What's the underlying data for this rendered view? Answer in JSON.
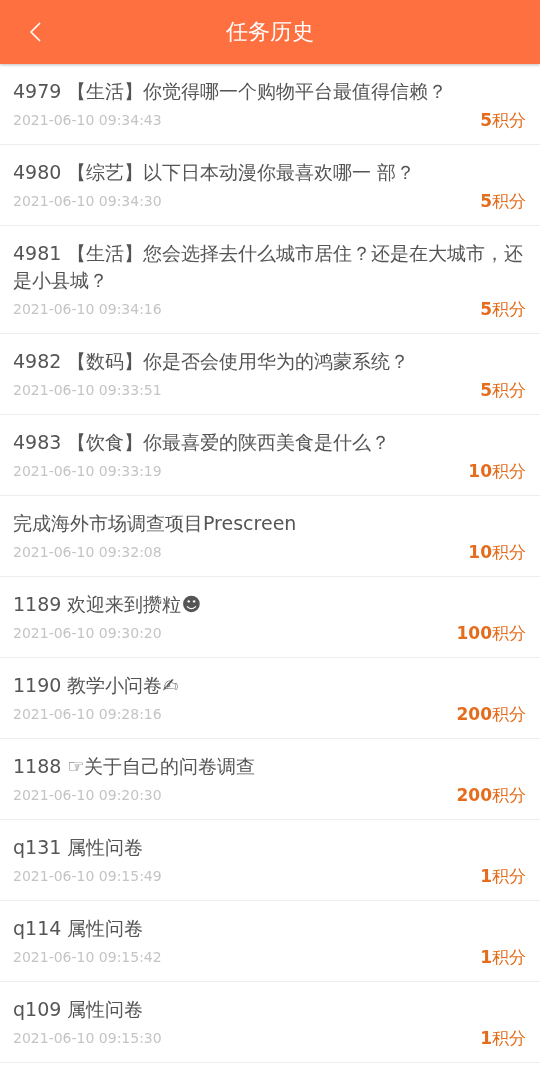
{
  "header": {
    "title": "任务历史"
  },
  "tasks": [
    {
      "title": "4979 【生活】你觉得哪一个购物平台最值得信赖？",
      "time": "2021-06-10 09:34:43",
      "points": "**5**积分"
    },
    {
      "title": "4980 【综艺】以下日本动漫你最喜欢哪一 部？",
      "time": "2021-06-10 09:34:30",
      "points": "**5**积分"
    },
    {
      "title": "4981 【生活】您会选择去什么城市居住？还是在大城市，还是小县城？",
      "time": "2021-06-10 09:34:16",
      "points": "**5**积分"
    },
    {
      "title": "4982 【数码】你是否会使用华为的鸿蒙系统？",
      "time": "2021-06-10 09:33:51",
      "points": "**5**积分"
    },
    {
      "title": "4983 【饮食】你最喜爱的陕西美食是什么？",
      "time": "2021-06-10 09:33:19",
      "points": "**10**积分"
    },
    {
      "title": "完成海外市场调查项目Prescreen",
      "time": "2021-06-10 09:32:08",
      "points": "**10**积分"
    },
    {
      "title": "1189 欢迎来到攒粒☻",
      "time": "2021-06-10 09:30:20",
      "points": "**100**积分"
    },
    {
      "title": "1190 教学小问卷✍",
      "time": "2021-06-10 09:28:16",
      "points": "**200**积分"
    },
    {
      "title": "1188 ☞关于自己的问卷调查",
      "time": "2021-06-10 09:20:30",
      "points": "**200**积分"
    },
    {
      "title": "q131 属性问卷",
      "time": "2021-06-10 09:15:49",
      "points": "**1**积分"
    },
    {
      "title": "q114 属性问卷",
      "time": "2021-06-10 09:15:42",
      "points": "**1**积分"
    },
    {
      "title": "q109 属性问卷",
      "time": "2021-06-10 09:15:30",
      "points": "**1**积分"
    }
  ]
}
